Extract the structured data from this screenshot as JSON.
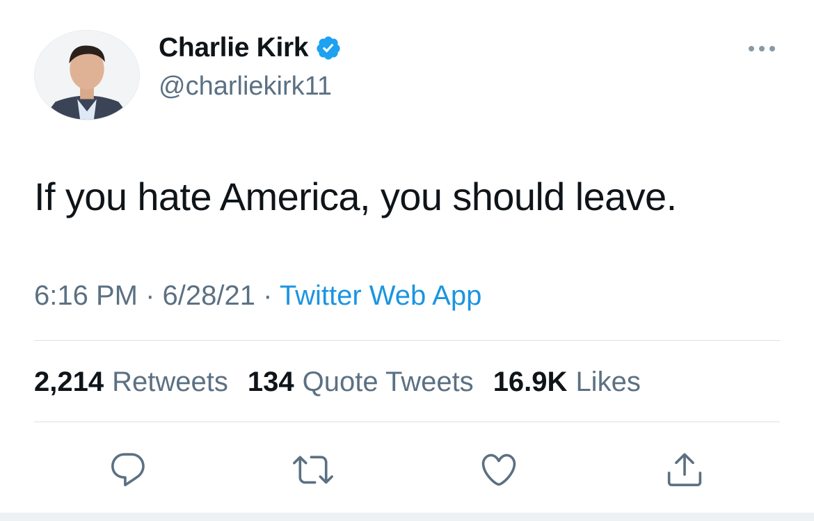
{
  "author": {
    "display_name": "Charlie Kirk",
    "handle": "@charliekirk11",
    "verified": true
  },
  "tweet": {
    "text": "If you hate America, you should leave.",
    "time": "6:16 PM",
    "date": "6/28/21",
    "separator": "·",
    "source": "Twitter Web App"
  },
  "stats": {
    "retweets": {
      "count": "2,214",
      "label": "Retweets"
    },
    "quotes": {
      "count": "134",
      "label": "Quote Tweets"
    },
    "likes": {
      "count": "16.9K",
      "label": "Likes"
    }
  },
  "icons": {
    "more": "more-dots-icon",
    "verified": "verified-badge-icon",
    "reply": "reply-icon",
    "retweet": "retweet-icon",
    "like": "heart-icon",
    "share": "share-icon"
  },
  "colors": {
    "link": "#1b95e0",
    "secondary_text": "#5b7083",
    "primary_text": "#0f1419",
    "verified": "#1da1f2",
    "divider": "#d9e1e8"
  }
}
